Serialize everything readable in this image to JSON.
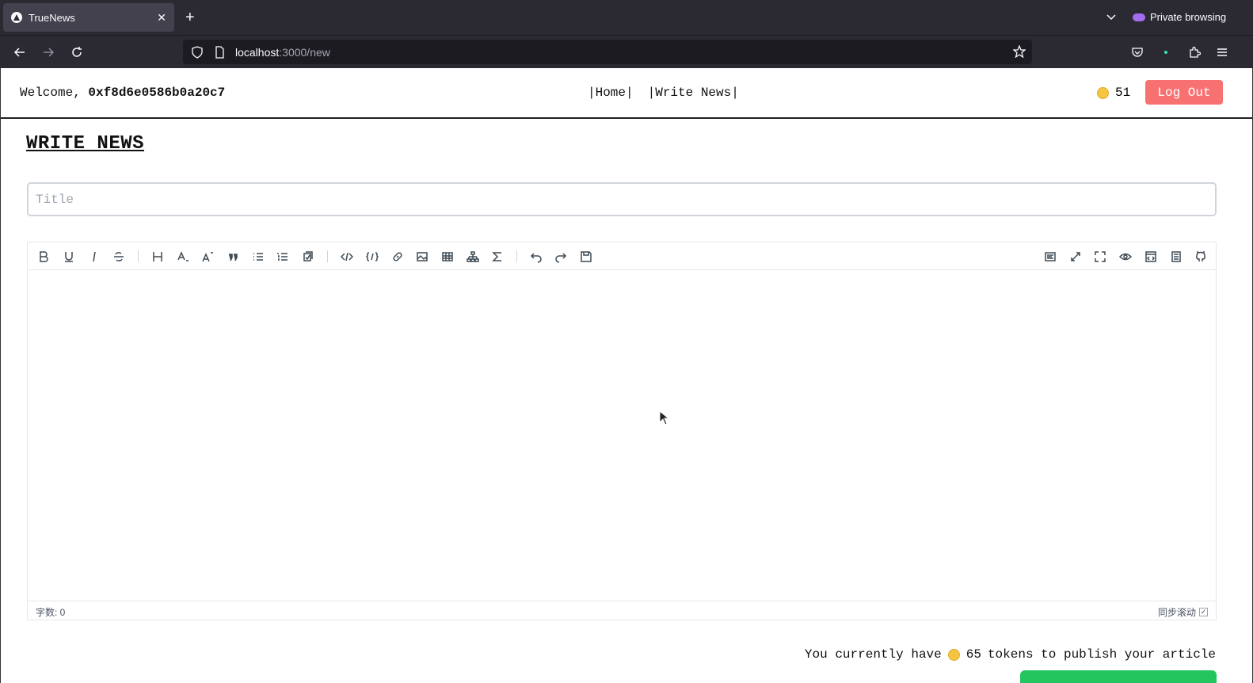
{
  "browser": {
    "tab_title": "TrueNews",
    "tab_close": "✕",
    "new_tab": "+",
    "private_label": "Private browsing",
    "url_host": "localhost",
    "url_path": ":3000/new"
  },
  "header": {
    "welcome_prefix": "Welcome, ",
    "address": "0xf8d6e0586b0a20c7",
    "nav": [
      "|Home|",
      "|Write News|"
    ],
    "coin_count": "51",
    "logout_label": "Log Out"
  },
  "main": {
    "heading": "WRITE NEWS",
    "title_placeholder": "Title",
    "editor": {
      "word_count_label": "字数: 0",
      "sync_scroll_label": "同步滚动",
      "sync_checked": "✓"
    },
    "tokens_prefix": "You currently have",
    "tokens_count": "65",
    "tokens_suffix": "tokens to publish your article"
  },
  "colors": {
    "logout_bg": "#f87171",
    "publish_bg": "#22c55e",
    "coin": "#f5c542"
  }
}
